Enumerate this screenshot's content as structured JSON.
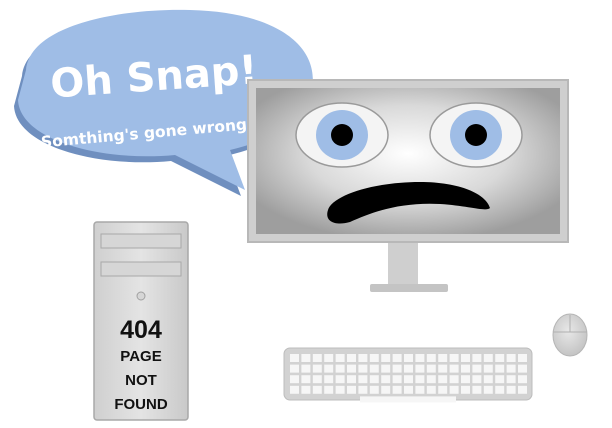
{
  "speech_bubble": {
    "title": "Oh Snap!",
    "subtitle": "Somthing's gone wrong!"
  },
  "tower_label": {
    "code": "404",
    "line1": "PAGE",
    "line2": "NOT",
    "line3": "FOUND"
  },
  "colors": {
    "bubble_fill": "#9fbde6",
    "bubble_shadow": "#6f8fbf",
    "eye_iris": "#9fbde6",
    "hardware_gray": "#cfcfcf",
    "hardware_outline": "#b3b3b3"
  },
  "icons": {
    "computer": "desktop-computer-icon",
    "mouse": "mouse-icon",
    "keyboard": "keyboard-icon"
  }
}
